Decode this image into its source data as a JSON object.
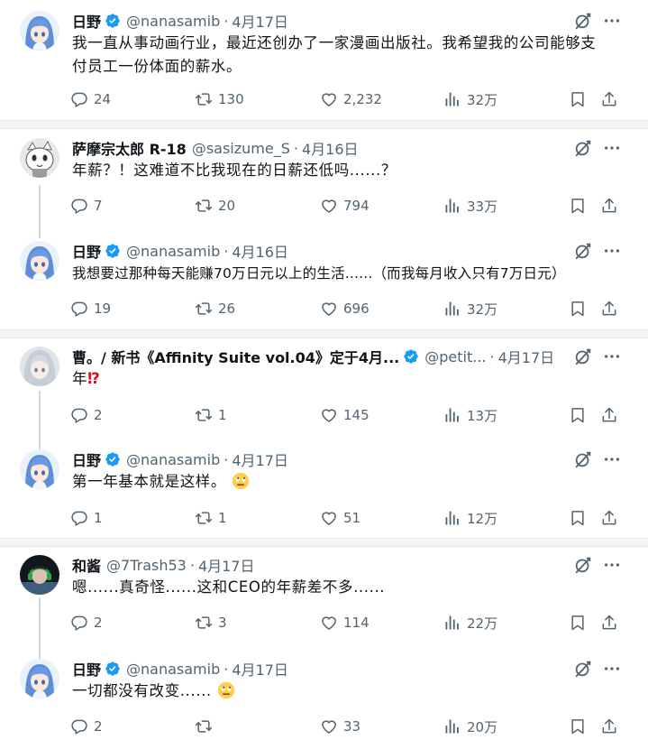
{
  "colors": {
    "verified": "#1d9bf0",
    "text": "#0f1419",
    "muted": "#536471",
    "separator": "#f2f4f5"
  },
  "tweets": [
    {
      "name": "日野",
      "verified": true,
      "handle": "@nanasamib",
      "dot": "·",
      "date": "4月17日",
      "avatar": "blue-haired-anime-girl",
      "text_lines": [
        "我一直从事动画行业，最近还创办了一家漫画出版社。我希望我的公司能够支",
        "付员工一份体面的薪水。"
      ],
      "replies": "24",
      "retweets": "130",
      "likes": "2,232",
      "views": "32万"
    },
    {
      "name": "萨摩宗太郎 R-18",
      "verified": false,
      "handle": "@sasizume_S",
      "dot": "·",
      "date": "4月16日",
      "avatar": "white-creature-sketch",
      "text_lines": [
        "年薪？！这难道不比我现在的日薪还低吗......？"
      ],
      "replies": "7",
      "retweets": "20",
      "likes": "794",
      "views": "33万"
    },
    {
      "name": "日野",
      "verified": true,
      "handle": "@nanasamib",
      "dot": "·",
      "date": "4月16日",
      "avatar": "blue-haired-anime-girl",
      "text_lines": [
        "我想要过那种每天能赚70万日元以上的生活......（而我每月收入只有7万日元）"
      ],
      "replies": "19",
      "retweets": "26",
      "likes": "696",
      "views": "32万"
    },
    {
      "name": "曹。/ 新书《Affinity Suite vol.04》定于4月...",
      "verified": true,
      "handle": "@petit...",
      "dot": "·",
      "date": "4月17日",
      "avatar": "silver-haired-anime-girl",
      "text_prefix": "年",
      "text_mark": "⁉",
      "replies": "2",
      "retweets": "1",
      "likes": "145",
      "views": "13万"
    },
    {
      "name": "日野",
      "verified": true,
      "handle": "@nanasamib",
      "dot": "·",
      "date": "4月17日",
      "avatar": "blue-haired-anime-girl",
      "text_lines": [
        "第一年基本就是这样。"
      ],
      "emoji": "rolling-eyes-emoji",
      "replies": "1",
      "retweets": "1",
      "likes": "51",
      "views": "12万"
    },
    {
      "name": "和酱",
      "verified": false,
      "handle": "@7Trash53",
      "dot": "·",
      "date": "4月17日",
      "avatar": "headphones-character",
      "text_lines": [
        "嗯......真奇怪......这和CEO的年薪差不多......"
      ],
      "replies": "2",
      "retweets": "3",
      "likes": "114",
      "views": "22万"
    },
    {
      "name": "日野",
      "verified": true,
      "handle": "@nanasamib",
      "dot": "·",
      "date": "4月17日",
      "avatar": "blue-haired-anime-girl",
      "text_lines": [
        "一切都没有改变......"
      ],
      "emoji": "rolling-eyes-emoji",
      "replies": "2",
      "retweets": "",
      "likes": "33",
      "views": "20万"
    }
  ]
}
